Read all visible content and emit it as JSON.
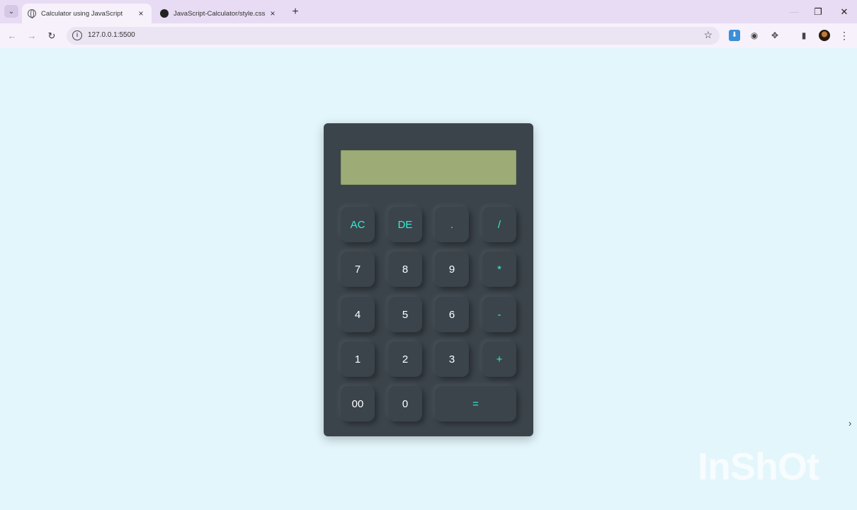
{
  "browser": {
    "tabs": [
      {
        "title": "Calculator using JavaScript",
        "close": "×"
      },
      {
        "title": "JavaScript-Calculator/style.css a",
        "close": "×"
      }
    ],
    "new_tab": "+",
    "tab_menu": "⌄",
    "window": {
      "minimize": "—",
      "restore": "❐",
      "close": "✕"
    },
    "nav": {
      "back": "←",
      "forward": "→",
      "reload": "↻"
    },
    "url": "127.0.0.1:5500",
    "site_info": "i",
    "bookmark": "☆",
    "menu": "⋮"
  },
  "calculator": {
    "display_value": "",
    "colors": {
      "body": "#3b444b",
      "display": "#9dab76",
      "operator": "#2ef0d3",
      "digit": "#ffffff"
    },
    "keys": [
      {
        "label": "AC",
        "type": "op"
      },
      {
        "label": "DE",
        "type": "op"
      },
      {
        "label": ".",
        "type": "op"
      },
      {
        "label": "/",
        "type": "op"
      },
      {
        "label": "7",
        "type": "digit"
      },
      {
        "label": "8",
        "type": "digit"
      },
      {
        "label": "9",
        "type": "digit"
      },
      {
        "label": "*",
        "type": "op"
      },
      {
        "label": "4",
        "type": "digit"
      },
      {
        "label": "5",
        "type": "digit"
      },
      {
        "label": "6",
        "type": "digit"
      },
      {
        "label": "-",
        "type": "op"
      },
      {
        "label": "1",
        "type": "digit"
      },
      {
        "label": "2",
        "type": "digit"
      },
      {
        "label": "3",
        "type": "digit"
      },
      {
        "label": "+",
        "type": "op"
      },
      {
        "label": "00",
        "type": "digit"
      },
      {
        "label": "0",
        "type": "digit"
      },
      {
        "label": "=",
        "type": "op"
      }
    ]
  },
  "overlay": {
    "side_chevron": "›",
    "watermark": "InShOt"
  }
}
